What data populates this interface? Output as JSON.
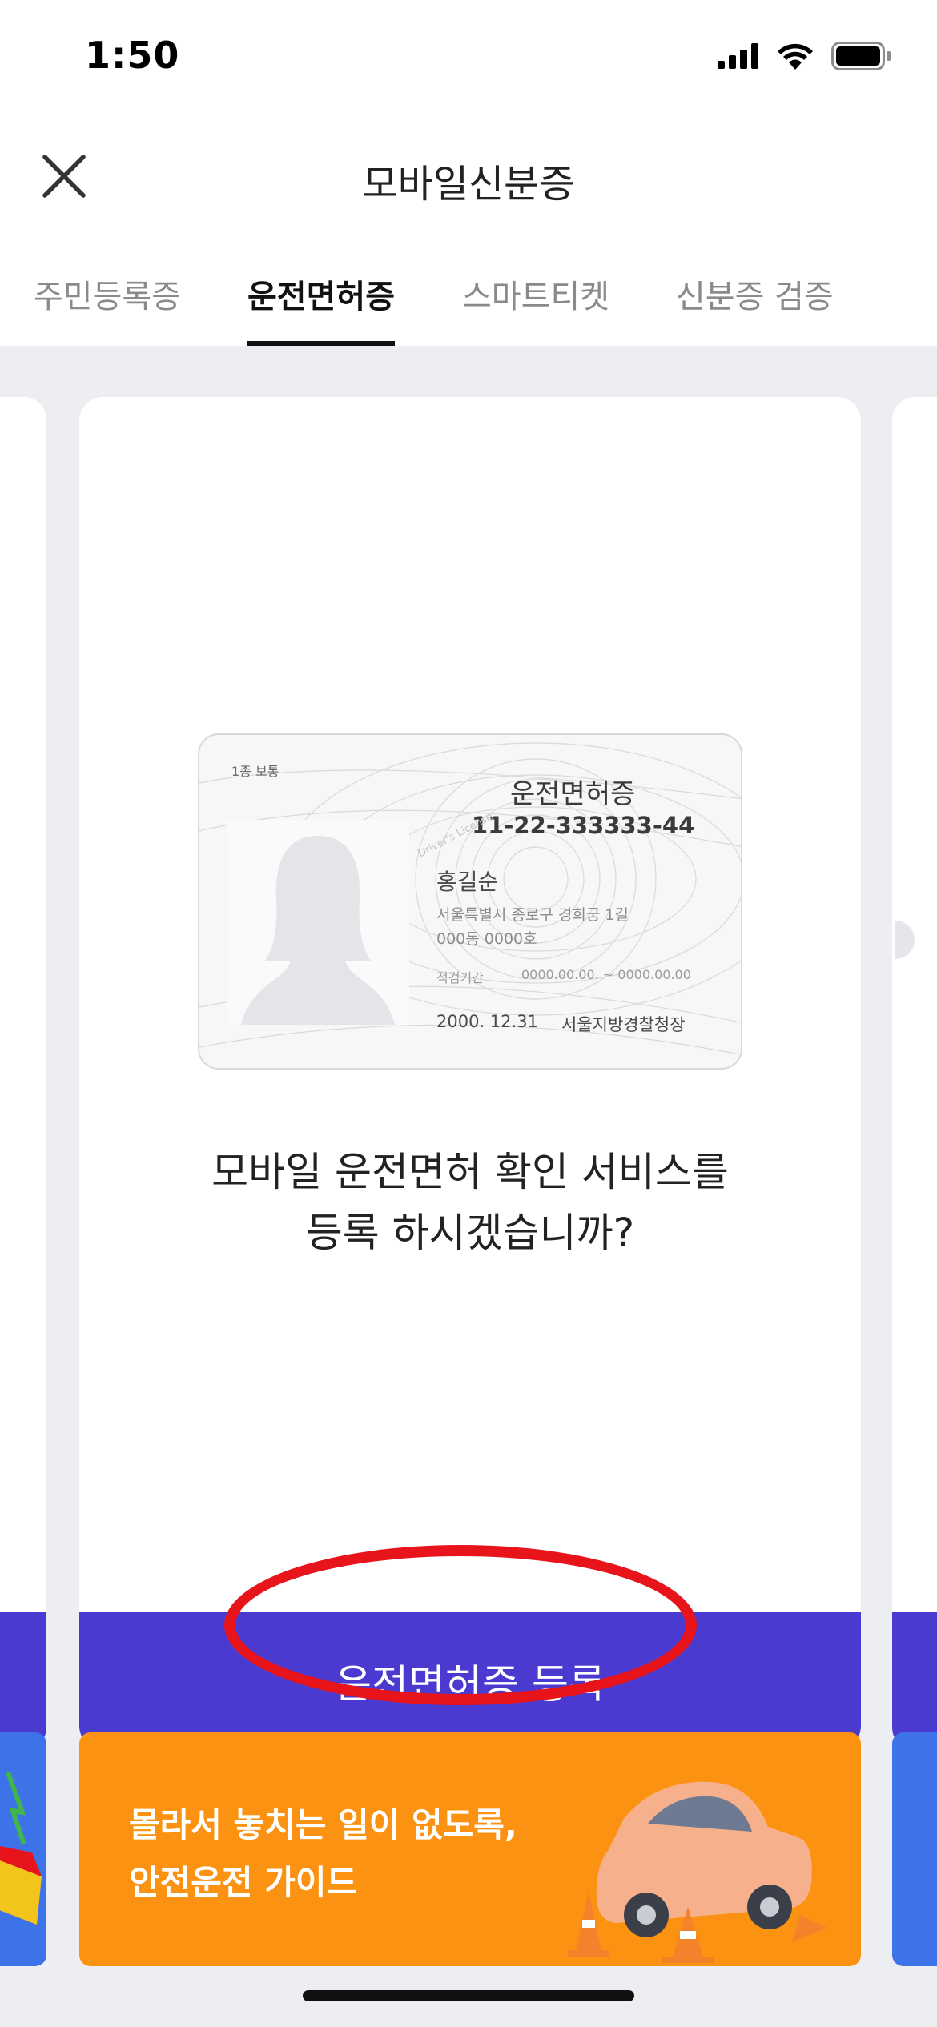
{
  "status_bar": {
    "time": "1:50"
  },
  "header": {
    "title": "모바일신분증",
    "close_icon": "close-icon"
  },
  "tabs": [
    {
      "label": "주민등록증",
      "active": false
    },
    {
      "label": "운전면허증",
      "active": true
    },
    {
      "label": "스마트티켓",
      "active": false
    },
    {
      "label": "신분증 검증",
      "active": false
    }
  ],
  "license_card": {
    "class": "1종 보통",
    "title": "운전면허증",
    "number": "11-22-333333-44",
    "name": "홍길순",
    "address_line1": "서울특별시 종로구 경희궁 1길",
    "address_line2": "000동 0000호",
    "validity_label": "적검기간",
    "validity_value": "0000.00.00. ~ 0000.00.00",
    "issue_date": "2000. 12.31",
    "issuer": "서울지방경찰청장",
    "watermark": "Driver's License"
  },
  "prompt": {
    "line1": "모바일 운전면허 확인 서비스를",
    "line2": "등록 하시겠습니까?"
  },
  "register_button": {
    "label": "운전면허증 등록"
  },
  "banner": {
    "line1": "몰라서 놓치는 일이 없도록,",
    "line2": "안전운전 가이드"
  },
  "colors": {
    "accent_purple": "#4a3ad0",
    "banner_orange": "#fb9211",
    "annotation_red": "#e8141c",
    "side_banner_blue": "#3e72e8"
  }
}
